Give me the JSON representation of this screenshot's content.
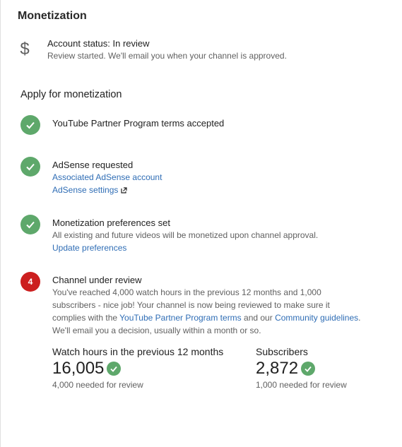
{
  "page": {
    "title": "Monetization"
  },
  "account": {
    "icon": "dollar-icon",
    "status": "Account status: In review",
    "description": "Review started. We'll email you when your channel is approved."
  },
  "apply": {
    "title": "Apply for monetization",
    "steps": [
      {
        "badge": "check",
        "title": "YouTube Partner Program terms accepted"
      },
      {
        "badge": "check",
        "title": "AdSense requested",
        "links": [
          "Associated AdSense account",
          "AdSense settings"
        ]
      },
      {
        "badge": "check",
        "title": "Monetization preferences set",
        "description": "All existing and future videos will be monetized upon channel approval.",
        "links": [
          "Update preferences"
        ]
      },
      {
        "badge": "4",
        "title": "Channel under review",
        "paragraph": {
          "part1": "You've reached 4,000 watch hours in the previous 12 months and 1,000 subscribers - nice job! Your channel is now being reviewed to make sure it complies with the ",
          "link1": "YouTube Partner Program terms",
          "part2": " and our ",
          "link2": "Community guidelines",
          "part3": ". We'll email you a decision, usually within a month or so."
        }
      }
    ]
  },
  "stats": [
    {
      "label": "Watch hours in the previous 12 months",
      "value": "16,005",
      "sub": "4,000 needed for review"
    },
    {
      "label": "Subscribers",
      "value": "2,872",
      "sub": "1,000 needed for review"
    }
  ],
  "colors": {
    "success": "#5ea86b",
    "alert": "#cc1f1f",
    "link": "#2f6db5"
  }
}
